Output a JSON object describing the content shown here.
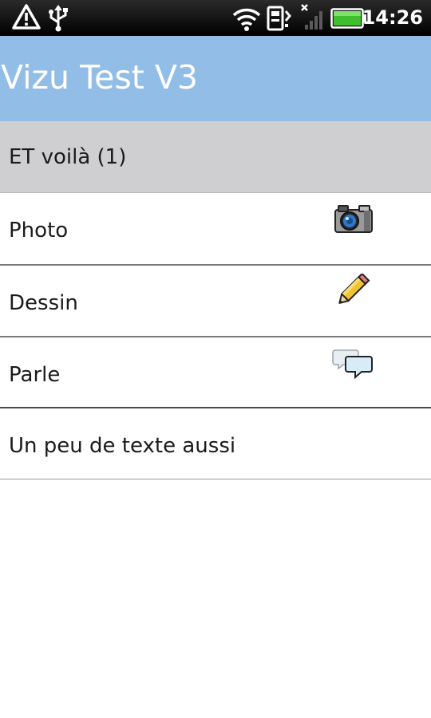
{
  "status_bar": {
    "time": "14:26",
    "icons": [
      "alert-triangle-icon",
      "usb-icon",
      "wifi-icon",
      "sim-data-icon",
      "no-signal-icon",
      "battery-icon"
    ],
    "battery_color": "#3fbf2e"
  },
  "app": {
    "title": "Vizu Test V3",
    "title_bar_color": "#92bde6"
  },
  "list": {
    "section_header": "ET voilà (1)",
    "items": [
      {
        "label": "Photo",
        "icon": "camera-icon"
      },
      {
        "label": "Dessin",
        "icon": "pencil-icon"
      },
      {
        "label": "Parle",
        "icon": "speech-bubbles-icon"
      },
      {
        "label": "Un peu de texte aussi",
        "icon": ""
      }
    ]
  }
}
